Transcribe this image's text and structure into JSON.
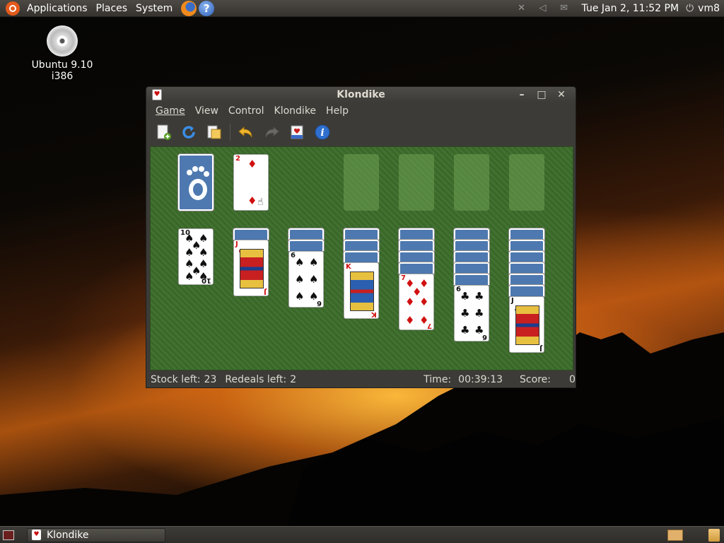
{
  "top_panel": {
    "menus": [
      "Applications",
      "Places",
      "System"
    ],
    "clock": "Tue Jan  2, 11:52 PM",
    "user": "vm8"
  },
  "desktop": {
    "icon_label": "Ubuntu 9.10 i386"
  },
  "window": {
    "title": "Klondike",
    "menu": [
      "Game",
      "View",
      "Control",
      "Klondike",
      "Help"
    ],
    "toolbar": [
      "new-game-icon",
      "restart-icon",
      "hint-icon",
      "undo-icon",
      "redo-icon",
      "deal-icon",
      "info-icon"
    ],
    "stock_card": {
      "rank": "2",
      "suit": "♦"
    },
    "tableau": [
      {
        "hidden": 0,
        "face": {
          "rank": "10",
          "suit": "♠"
        }
      },
      {
        "hidden": 1,
        "face": {
          "rank": "J",
          "suit": "♥"
        }
      },
      {
        "hidden": 2,
        "face": {
          "rank": "6",
          "suit": "♠"
        }
      },
      {
        "hidden": 3,
        "face": {
          "rank": "K",
          "suit": "♦"
        }
      },
      {
        "hidden": 4,
        "face": {
          "rank": "7",
          "suit": "♦"
        }
      },
      {
        "hidden": 5,
        "face": {
          "rank": "6",
          "suit": "♣"
        }
      },
      {
        "hidden": 6,
        "face": {
          "rank": "J",
          "suit": "♣"
        }
      }
    ],
    "status": {
      "stock_label": "Stock left:",
      "stock_value": "23",
      "redeals_label": "Redeals left:",
      "redeals_value": "2",
      "time_label": "Time:",
      "time_value": "00:39:13",
      "score_label": "Score:",
      "score_value": "0"
    }
  },
  "taskbar": {
    "task_label": "Klondike"
  },
  "colors": {
    "felt": "#3b6b2a",
    "card_back": "#4e79b0",
    "panel": "#3c3b37"
  }
}
